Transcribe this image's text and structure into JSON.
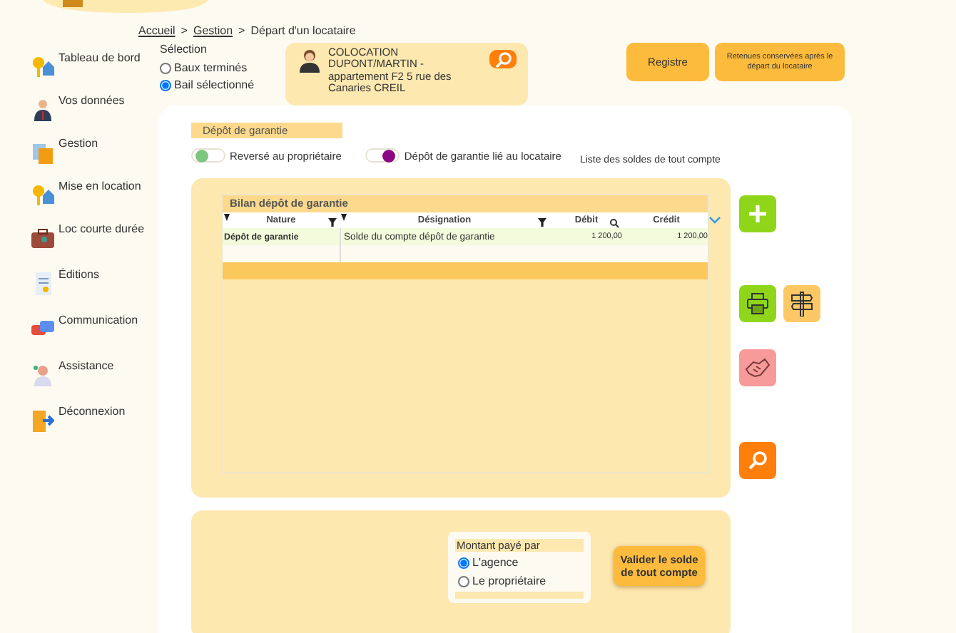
{
  "breadcrumb": [
    {
      "label": "Accueil",
      "kind": "link"
    },
    {
      "label": ">",
      "kind": "separator"
    },
    {
      "label": "Gestion",
      "kind": "link"
    },
    {
      "label": ">",
      "kind": "separator"
    },
    {
      "label": "Départ d'un locataire",
      "kind": "current"
    }
  ],
  "sidebar": {
    "items": [
      {
        "label": "Tableau de bord",
        "kind": "keys"
      },
      {
        "label": "Vos données",
        "kind": "person"
      },
      {
        "label": "Gestion",
        "kind": "folder"
      },
      {
        "label": "Mise en location",
        "kind": "keys"
      },
      {
        "label": "Loc courte durée",
        "kind": "suitcase"
      },
      {
        "label": "Éditions",
        "kind": "document"
      },
      {
        "label": "Communication",
        "kind": "chat"
      },
      {
        "label": "Assistance",
        "kind": "agent"
      },
      {
        "label": "Déconnexion",
        "kind": "exit"
      }
    ]
  },
  "selection": {
    "title": "Sélection",
    "options": [
      {
        "label": "Baux terminés",
        "selected": false
      },
      {
        "label": "Bail sélectionné",
        "selected": true
      }
    ]
  },
  "lease_card": {
    "text": "COLOCATION DUPONT/MARTIN - appartement F2 5 rue des Canaries CREIL"
  },
  "top_buttons": [
    "Registre",
    "Retenues conservées après le départ du locataire"
  ],
  "section_title": "Dépôt de garantie",
  "toggles": [
    {
      "label": "Reversé au propriétaire",
      "on": false,
      "color": "#7dc67e"
    },
    {
      "label": "Dépôt de garantie lié au locataire",
      "on": true,
      "color": "#8b0a83"
    }
  ],
  "list_caption": "Liste des soldes de tout compte",
  "table": {
    "title": "Bilan dépôt de garantie",
    "columns": [
      {
        "label": "Nature",
        "filter": true,
        "search": false
      },
      {
        "label": "Désignation",
        "filter": true,
        "search": false
      },
      {
        "label": "Débit",
        "filter": false,
        "search": true
      },
      {
        "label": "Crédit",
        "filter": false,
        "search": false
      }
    ],
    "rows": [
      [
        "Dépôt de garantie",
        "Solde du compte dépôt de garantie",
        "1 200,00",
        "1 200,00"
      ]
    ]
  },
  "side_actions": [
    {
      "kind": "add",
      "color": "#8fd61a"
    },
    {
      "kind": "print",
      "color": "#8fd61a"
    },
    {
      "kind": "signpost",
      "color": "#fcc865"
    },
    {
      "kind": "handshake",
      "color": "#f99a9a"
    },
    {
      "kind": "search",
      "color": "#ff7f0a"
    }
  ],
  "payer": {
    "title": "Montant payé par",
    "options": [
      {
        "label": "L'agence",
        "selected": true
      },
      {
        "label": "Le propriétaire",
        "selected": false
      }
    ]
  },
  "validate_button": "Valider le solde de tout compte"
}
